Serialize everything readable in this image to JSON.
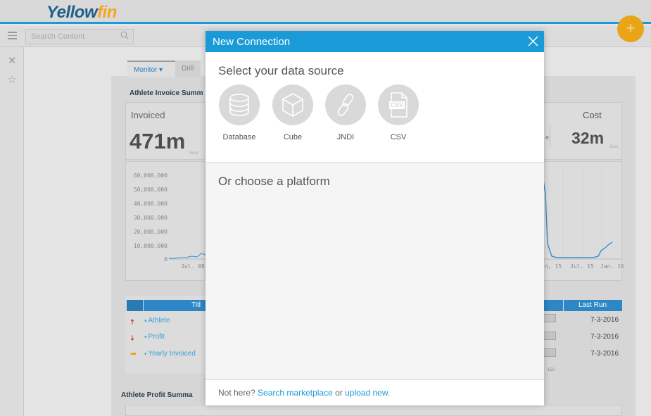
{
  "app": {
    "logo_main": "Yellow",
    "logo_accent": "fin"
  },
  "search": {
    "placeholder": "Search Content"
  },
  "fab": {
    "label": "+"
  },
  "rail": {
    "close_glyph": "✕",
    "favorite_glyph": "☆"
  },
  "dashboard": {
    "tabs": [
      {
        "label": "Monitor ▾"
      },
      {
        "label": "Drill"
      }
    ],
    "title": "Athlete Invoice Summ",
    "kpi": {
      "label": "Invoiced",
      "value": "471m",
      "sub": "Sum"
    },
    "y_ticks": [
      "60,000,000",
      "50,000,000",
      "40,000,000",
      "30,000,000",
      "20,000,000",
      "10,000,000",
      "0"
    ],
    "x_left": "Jul. 09",
    "right_kpi": {
      "label": "Cost",
      "value": "32m",
      "sub": "Sum",
      "edge_letter": "e"
    },
    "x_right": [
      "n, 15",
      "Jul. 15",
      "Jan. 16"
    ],
    "table": {
      "title_header": "Titl",
      "last_run_header": "Last Run",
      "rows": [
        {
          "name": "Athlete",
          "arrow": "🠅",
          "last_run": "7-3-2016"
        },
        {
          "name": "Profit",
          "arrow": "🠇",
          "last_run": "7-3-2016"
        },
        {
          "name": "Yearly Invoiced",
          "arrow": "➡",
          "last_run": "7-3-2016"
        }
      ],
      "axis_tick": "150"
    },
    "profit_title": "Athlete Profit Summa"
  },
  "modal": {
    "title": "New Connection",
    "subtitle": "Select your data source",
    "sources": [
      {
        "label": "Database",
        "icon": "database-icon"
      },
      {
        "label": "Cube",
        "icon": "cube-icon"
      },
      {
        "label": "JNDI",
        "icon": "link-icon"
      },
      {
        "label": "CSV",
        "icon": "csv-file-icon"
      }
    ],
    "csv_icon_text": "CSV",
    "platform_title": "Or choose a platform",
    "footer": {
      "prefix": "Not here? ",
      "marketplace_link": "Search marketplace",
      "middle": " or ",
      "upload_link": "upload new."
    }
  },
  "colors": {
    "accent": "#1a9bd7",
    "fab": "#e9a417",
    "table_header": "#2d86c5",
    "link": "#3aa0d8"
  }
}
